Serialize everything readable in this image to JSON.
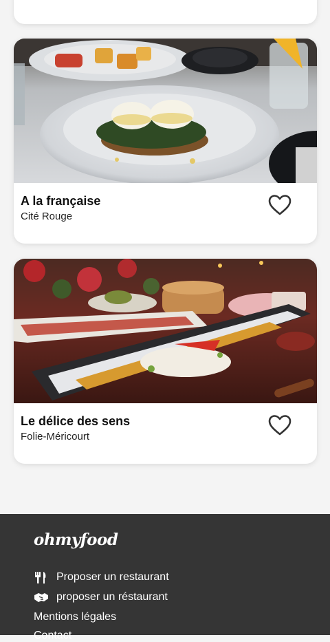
{
  "restaurants": [
    {
      "name": "A la française",
      "location": "Cité Rouge",
      "image": "eggs-benedict-dish-photo"
    },
    {
      "name": "Le délice des sens",
      "location": "Folie-Méricourt",
      "image": "fish-platter-photo"
    }
  ],
  "footer": {
    "logo": "ohmyfood",
    "links": [
      {
        "label": "Proposer un restaurant",
        "icon": "utensils-icon"
      },
      {
        "label": "proposer un réstaurant",
        "icon": "handshake-icon"
      },
      {
        "label": "Mentions légales"
      },
      {
        "label": "Contact"
      }
    ]
  },
  "colors": {
    "footer_bg": "#353535",
    "page_bg": "#f4f4f4",
    "card_bg": "#ffffff"
  }
}
